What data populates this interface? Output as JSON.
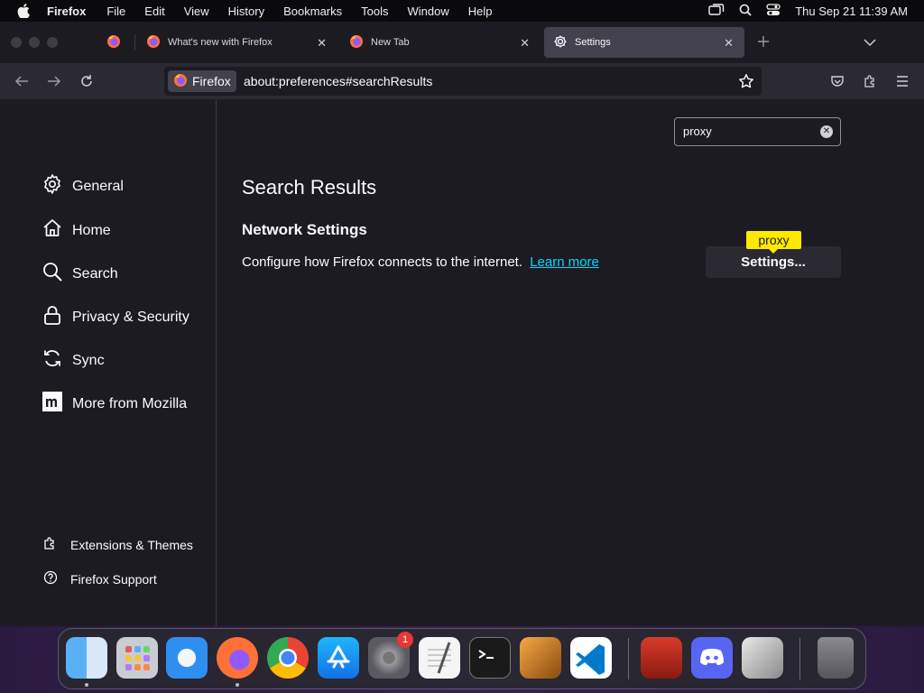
{
  "menubar": {
    "app": "Firefox",
    "items": [
      "File",
      "Edit",
      "View",
      "History",
      "Bookmarks",
      "Tools",
      "Window",
      "Help"
    ],
    "clock": "Thu Sep 21  11:39 AM"
  },
  "tabs": [
    {
      "title": "What's new with Firefox",
      "icon": "firefox-icon",
      "active": false
    },
    {
      "title": "New Tab",
      "icon": "firefox-icon",
      "active": false
    },
    {
      "title": "Settings",
      "icon": "gear-icon",
      "active": true
    }
  ],
  "navbar": {
    "identity_label": "Firefox",
    "url": "about:preferences#searchResults"
  },
  "sidebar": {
    "categories": [
      {
        "label": "General",
        "icon": "gear-icon"
      },
      {
        "label": "Home",
        "icon": "home-icon"
      },
      {
        "label": "Search",
        "icon": "search-icon"
      },
      {
        "label": "Privacy & Security",
        "icon": "lock-icon"
      },
      {
        "label": "Sync",
        "icon": "sync-icon"
      },
      {
        "label": "More from Mozilla",
        "icon": "mozilla-icon"
      }
    ],
    "footer": [
      {
        "label": "Extensions & Themes",
        "icon": "puzzle-icon"
      },
      {
        "label": "Firefox Support",
        "icon": "help-icon"
      }
    ]
  },
  "search": {
    "value": "proxy"
  },
  "results": {
    "title": "Search Results",
    "section_title": "Network Settings",
    "description": "Configure how Firefox connects to the internet.",
    "learn_more": "Learn more",
    "button_label": "Settings...",
    "highlight_tip": "proxy"
  },
  "dock": {
    "apps": [
      "Finder",
      "Launchpad",
      "Safari",
      "Firefox",
      "Chrome",
      "App Store",
      "System Preferences",
      "TextEdit",
      "Terminal",
      "GarageBand",
      "VS Code",
      "Photo Theater Pro",
      "Discord",
      "Disk Utility",
      "Trash"
    ],
    "system_prefs_badge": "1"
  },
  "colors": {
    "accent": "#00ddff",
    "highlight": "#ffe900",
    "background": "#1c1b22"
  }
}
